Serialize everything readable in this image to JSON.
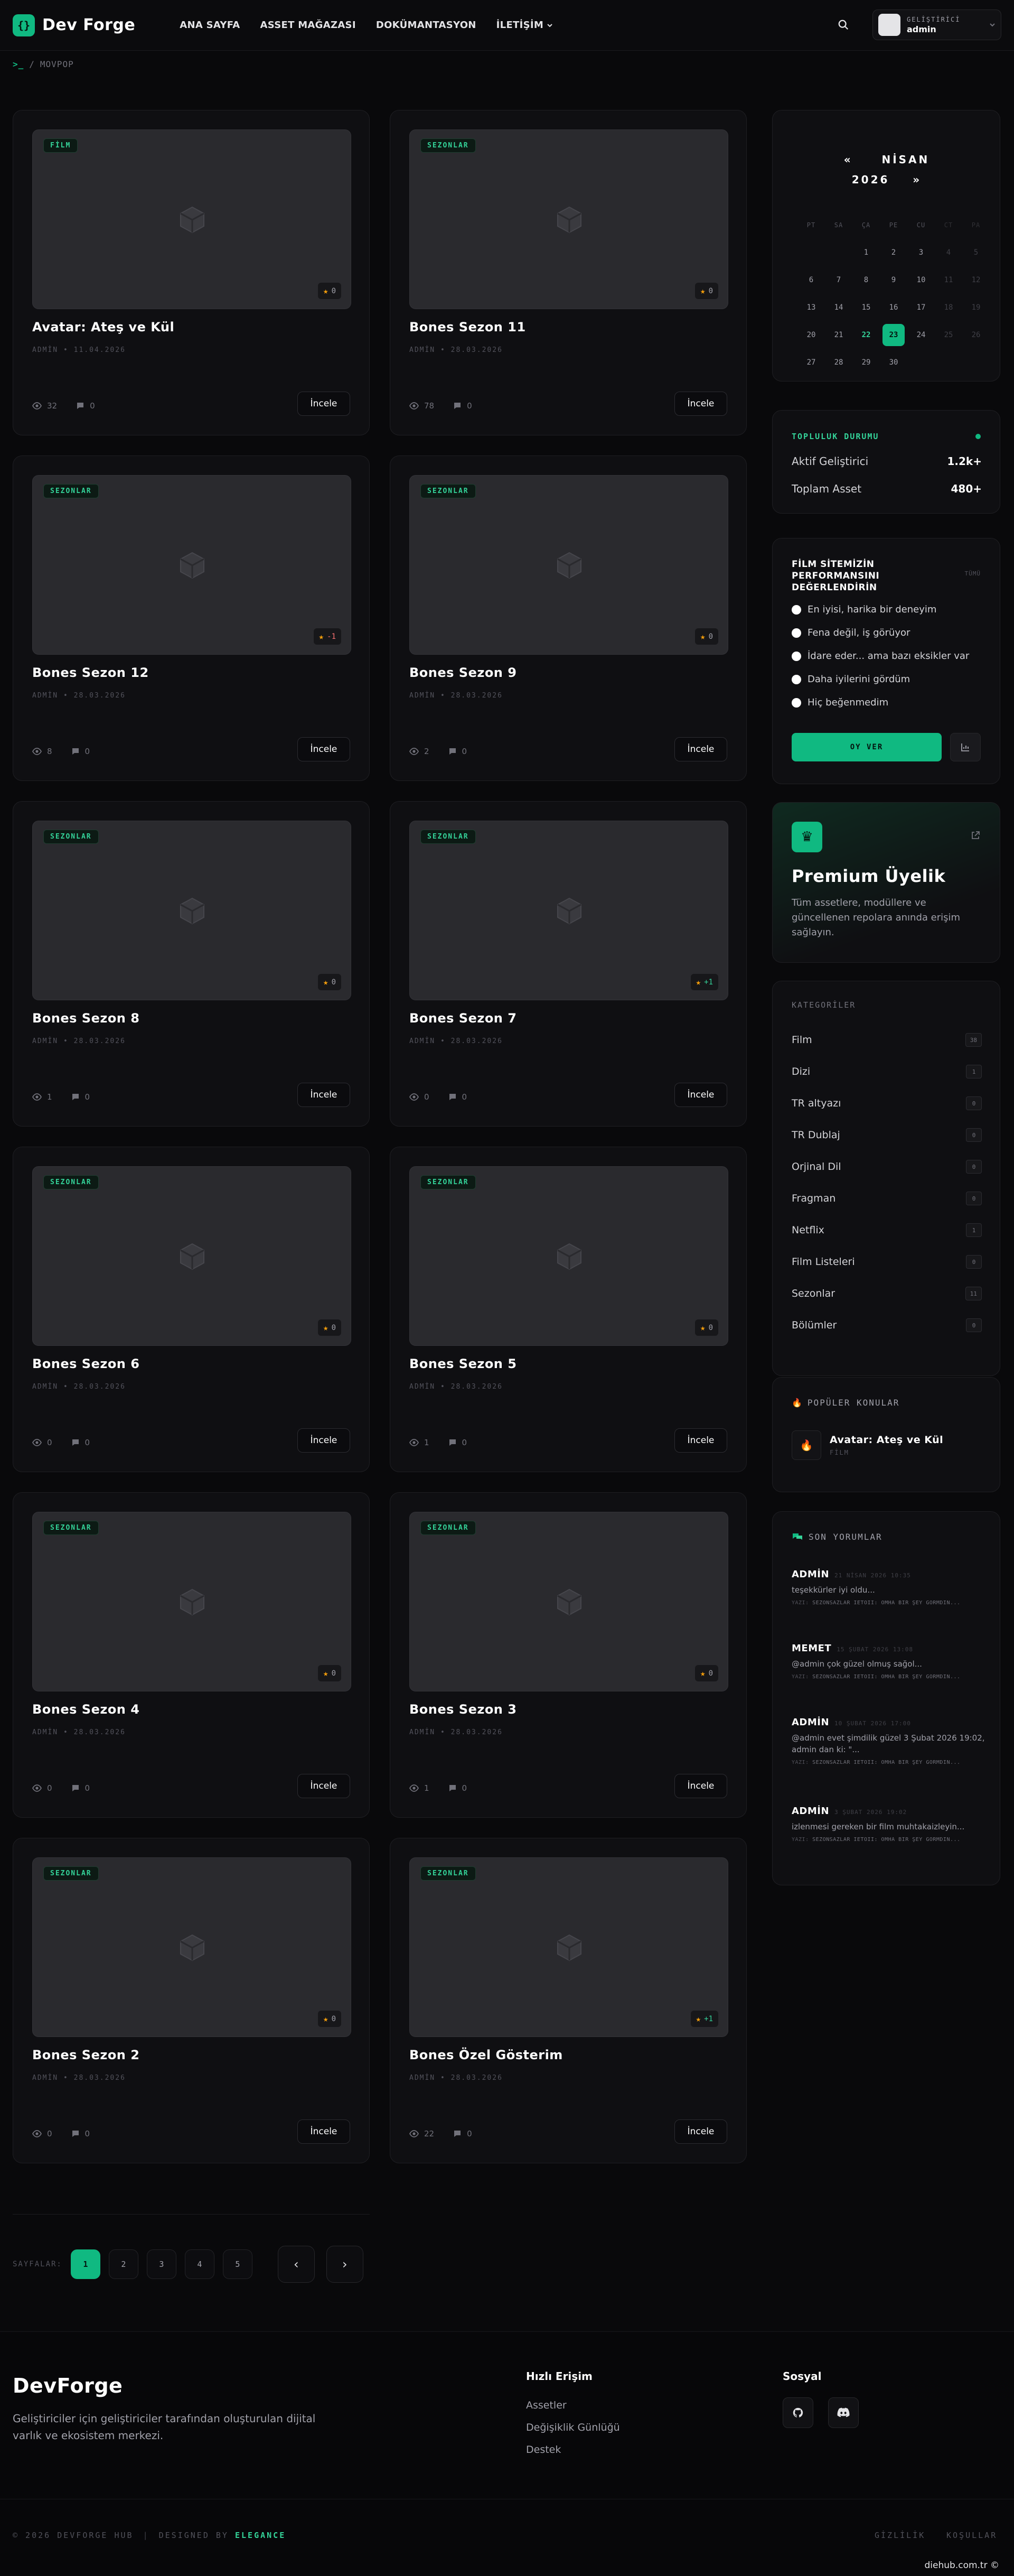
{
  "header": {
    "brand": "Dev Forge",
    "logo_glyph": "{}",
    "nav": [
      "ANA SAYFA",
      "ASSET MAĞAZASI",
      "DOKÜMANTASYON",
      "İLETİŞİM"
    ],
    "user_role": "GELİŞTİRİCİ",
    "user_name": "admin"
  },
  "breadcrumb": {
    "prompt": ">_",
    "sep": "/",
    "current": "MOVPOP"
  },
  "cards": [
    {
      "category": "FİLM",
      "rating": "0",
      "title": "Avatar: Ateş ve Kül",
      "author": "ADMİN",
      "date": "11.04.2026",
      "views": "32",
      "comments": "0",
      "button": "İncele"
    },
    {
      "category": "SEZONLAR",
      "rating": "0",
      "title": "Bones Sezon 11",
      "author": "ADMİN",
      "date": "28.03.2026",
      "views": "78",
      "comments": "0",
      "button": "İncele"
    },
    {
      "category": "SEZONLAR",
      "rating": "-1",
      "title": "Bones Sezon 12",
      "author": "ADMİN",
      "date": "28.03.2026",
      "views": "8",
      "comments": "0",
      "button": "İncele"
    },
    {
      "category": "SEZONLAR",
      "rating": "0",
      "title": "Bones Sezon 9",
      "author": "ADMİN",
      "date": "28.03.2026",
      "views": "2",
      "comments": "0",
      "button": "İncele"
    },
    {
      "category": "SEZONLAR",
      "rating": "0",
      "title": "Bones Sezon 8",
      "author": "ADMİN",
      "date": "28.03.2026",
      "views": "1",
      "comments": "0",
      "button": "İncele"
    },
    {
      "category": "SEZONLAR",
      "rating": "+1",
      "title": "Bones Sezon 7",
      "author": "ADMİN",
      "date": "28.03.2026",
      "views": "0",
      "comments": "0",
      "button": "İncele"
    },
    {
      "category": "SEZONLAR",
      "rating": "0",
      "title": "Bones Sezon 6",
      "author": "ADMİN",
      "date": "28.03.2026",
      "views": "0",
      "comments": "0",
      "button": "İncele"
    },
    {
      "category": "SEZONLAR",
      "rating": "0",
      "title": "Bones Sezon 5",
      "author": "ADMİN",
      "date": "28.03.2026",
      "views": "1",
      "comments": "0",
      "button": "İncele"
    },
    {
      "category": "SEZONLAR",
      "rating": "0",
      "title": "Bones Sezon 4",
      "author": "ADMİN",
      "date": "28.03.2026",
      "views": "0",
      "comments": "0",
      "button": "İncele"
    },
    {
      "category": "SEZONLAR",
      "rating": "0",
      "title": "Bones Sezon 3",
      "author": "ADMİN",
      "date": "28.03.2026",
      "views": "1",
      "comments": "0",
      "button": "İncele"
    },
    {
      "category": "SEZONLAR",
      "rating": "0",
      "title": "Bones Sezon 2",
      "author": "ADMİN",
      "date": "28.03.2026",
      "views": "0",
      "comments": "0",
      "button": "İncele"
    },
    {
      "category": "SEZONLAR",
      "rating": "+1",
      "title": "Bones Özel Gösterim",
      "author": "ADMİN",
      "date": "28.03.2026",
      "views": "22",
      "comments": "0",
      "button": "İncele"
    }
  ],
  "pagination": {
    "label": "SAYFALAR:",
    "pages": [
      "1",
      "2",
      "3",
      "4",
      "5"
    ],
    "active": "1",
    "prev": "‹",
    "next": "›"
  },
  "calendar": {
    "prev": "«",
    "month": "NİSAN",
    "year": "2026",
    "next": "»",
    "weekdays": [
      "PT",
      "SA",
      "ÇA",
      "PE",
      "CU",
      "CT",
      "PA"
    ],
    "days": [
      [
        "",
        "",
        "1",
        "2",
        "3",
        "4",
        "5"
      ],
      [
        "6",
        "7",
        "8",
        "9",
        "10",
        "11",
        "12"
      ],
      [
        "13",
        "14",
        "15",
        "16",
        "17",
        "18",
        "19"
      ],
      [
        "20",
        "21",
        "22",
        "23",
        "24",
        "25",
        "26"
      ],
      [
        "27",
        "28",
        "29",
        "30",
        "",
        "",
        ""
      ]
    ],
    "today": "22",
    "selected": "23"
  },
  "community": {
    "title": "TOPLULUK DURUMU",
    "rows": [
      {
        "label": "Aktif Geliştirici",
        "value": "1.2k+"
      },
      {
        "label": "Toplam Asset",
        "value": "480+"
      }
    ]
  },
  "poll": {
    "title": "FİLM SİTEMİZİN PERFORMANSINI DEĞERLENDİRİN",
    "tag": "TÜMÜ",
    "options": [
      "En iyisi, harika bir deneyim",
      "Fena değil, iş görüyor",
      "İdare eder... ama bazı eksikler var",
      "Daha iyilerini gördüm",
      "Hiç beğenmedim"
    ],
    "vote_label": "OY VER"
  },
  "premium": {
    "title": "Premium Üyelik",
    "desc": "Tüm assetlere, modüllere ve güncellenen repolara anında erişim sağlayın."
  },
  "categories": {
    "title": "KATEGORİLER",
    "items": [
      {
        "name": "Film",
        "count": "38"
      },
      {
        "name": "Dizi",
        "count": "1"
      },
      {
        "name": "TR altyazı",
        "count": "0"
      },
      {
        "name": "TR Dublaj",
        "count": "0"
      },
      {
        "name": "Orjinal Dil",
        "count": "0"
      },
      {
        "name": "Fragman",
        "count": "0"
      },
      {
        "name": "Netflix",
        "count": "1"
      },
      {
        "name": "Film Listeleri",
        "count": "0"
      },
      {
        "name": "Sezonlar",
        "count": "11"
      },
      {
        "name": "Bölümler",
        "count": "0"
      }
    ]
  },
  "popular": {
    "title": "POPÜLER KONULAR",
    "item_title": "Avatar: Ateş ve Kül",
    "item_cat": "FİLM"
  },
  "comments": {
    "title": "SON YORUMLAR",
    "items": [
      {
        "author": "ADMİN",
        "date": "21 NİSAN 2026 10:35",
        "text": "teşekkürler iyi oldu...",
        "ref_prefix": "YAZI:",
        "ref": "SEZONSAZLAR İETOİI: OMHA BİR ŞEY GÖRMDİN..."
      },
      {
        "author": "MEMET",
        "date": "15 ŞUBAT 2026 13:08",
        "text": "@admin çok güzel olmuş sağol...",
        "ref_prefix": "YAZI:",
        "ref": "SEZONSAZLAR İETOİI: OMHA BİR ŞEY GÖRMDİN..."
      },
      {
        "author": "ADMİN",
        "date": "10 ŞUBAT 2026 17:00",
        "text": "@admin evet şimdilik güzel 3 Şubat 2026 19:02, admin dan ki: \"...",
        "ref_prefix": "YAZI:",
        "ref": "SEZONSAZLAR İETOİI: OMHA BİR ŞEY GÖRMDİN..."
      },
      {
        "author": "ADMİN",
        "date": "3 ŞUBAT 2026 19:02",
        "text": "izlenmesi gereken bir film muhtakaizleyin...",
        "ref_prefix": "YAZI:",
        "ref": "SEZONSAZLAR İETOİI: OMHA BİR ŞEY GÖRMDİN..."
      }
    ]
  },
  "footer": {
    "brand": "DevForge",
    "desc": "Geliştiriciler için geliştiriciler tarafından oluşturulan dijital varlık ve ekosistem merkezi.",
    "quick_title": "Hızlı Erişim",
    "quick_links": [
      "Assetler",
      "Değişiklik Günlüğü",
      "Destek"
    ],
    "social_title": "Sosyal",
    "copyright": "© 2026 DEVFORGE HUB",
    "designed_by": "DESIGNED BY",
    "designer": "ELEGANCE",
    "legal": [
      "GİZLİLİK",
      "KOŞULLAR"
    ],
    "watermark": "diehub.com.tr ©"
  },
  "icons": {
    "search": "search-icon",
    "eye": "eye-icon",
    "comment": "comment-icon",
    "star": "star-icon",
    "box": "box-icon",
    "crown": "crown-icon",
    "fire": "fire-icon",
    "chat": "chat-icon",
    "github": "github-icon",
    "discord": "discord-icon",
    "chart": "chart-icon",
    "external": "external-link-icon"
  },
  "colors": {
    "accent": "#10b981",
    "accent_text": "#34d399",
    "star": "#f59e0b",
    "negative": "#f87171",
    "bg": "#09090b"
  }
}
